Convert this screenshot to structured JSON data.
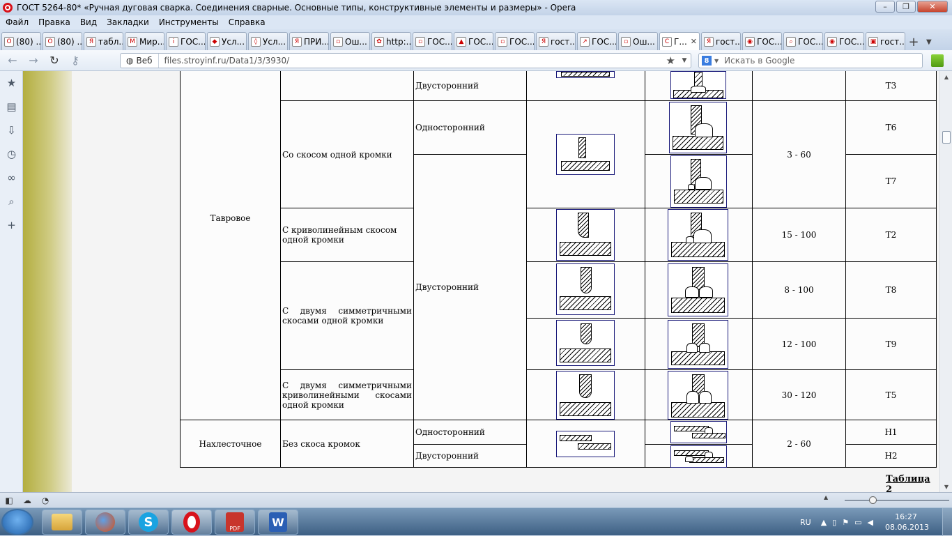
{
  "window": {
    "title": "ГОСТ 5264-80* «Ручная дуговая сварка. Соединения сварные. Основные типы, конструктивные элементы и размеры» - Opera",
    "controls": [
      "–",
      "❐",
      "✕"
    ]
  },
  "menu": [
    "Файл",
    "Правка",
    "Вид",
    "Закладки",
    "Инструменты",
    "Справка"
  ],
  "tabs": [
    {
      "label": "(80) ...",
      "fav": "О"
    },
    {
      "label": "(80) ...",
      "fav": "О"
    },
    {
      "label": "табл...",
      "fav": "Я"
    },
    {
      "label": "Мир...",
      "fav": "М"
    },
    {
      "label": "ГОС...",
      "fav": "i"
    },
    {
      "label": "Усл...",
      "fav": "◆"
    },
    {
      "label": "Усл...",
      "fav": "◊"
    },
    {
      "label": "ПРИ...",
      "fav": "Я"
    },
    {
      "label": "Ош...",
      "fav": "▫"
    },
    {
      "label": "http:...",
      "fav": "✿"
    },
    {
      "label": "ГОС...",
      "fav": "▫"
    },
    {
      "label": "ГОС...",
      "fav": "▲"
    },
    {
      "label": "ГОС...",
      "fav": "▫"
    },
    {
      "label": "гост...",
      "fav": "Я"
    },
    {
      "label": "ГОС...",
      "fav": "↗"
    },
    {
      "label": "Ош...",
      "fav": "▫"
    },
    {
      "label": "Г...",
      "fav": "C",
      "active": true
    },
    {
      "label": "гост...",
      "fav": "Я"
    },
    {
      "label": "ГОС...",
      "fav": "◉"
    },
    {
      "label": "ГОС...",
      "fav": "⌕"
    },
    {
      "label": "ГОС...",
      "fav": "◉"
    },
    {
      "label": "гост...",
      "fav": "▣"
    }
  ],
  "address": {
    "web_label": "Веб",
    "url": "files.stroyinf.ru/Data1/3/3930/",
    "search_placeholder": "Искать в Google"
  },
  "table": {
    "row_t3": {
      "weld_type": "Двусторонний",
      "code": "Т3"
    },
    "tavrovoe": "Тавровое",
    "skos_odnoy": "Со скосом одной кромки",
    "odnostoronniy": "Односторонний",
    "code_t6": "Т6",
    "code_t7": "Т7",
    "thick_3_60": "3 - 60",
    "krivolin": "С криволинейным скосом одной кромки",
    "thick_15_100": "15 - 100",
    "code_t2": "Т2",
    "dvustoronniy": "Двусторонний",
    "dve_simm": "С двумя симметричными скосами одной кромки",
    "thick_8_100": "8 - 100",
    "code_t8": "Т8",
    "thick_12_100": "12 - 100",
    "code_t9": "Т9",
    "dve_krivolin": "С двумя симметричными криволинейными скосами одной кромки",
    "thick_30_120": "30 - 120",
    "code_t5": "Т5",
    "nahlestochnoe": "Нахлесточное",
    "bez_skosa": "Без скоса кромок",
    "nah_one": "Односторонний",
    "nah_two": "Двусторонний",
    "thick_2_60": "2 - 60",
    "code_h1": "Н1",
    "code_h2": "Н2"
  },
  "table_label": "Таблица 2",
  "status": {
    "zoom_fraction": 0.25
  },
  "taskbar": {
    "lang": "RU",
    "time": "16:27",
    "date": "08.06.2013",
    "apps": [
      "file-explorer",
      "firefox",
      "skype",
      "opera",
      "pdf-reader",
      "word"
    ]
  }
}
